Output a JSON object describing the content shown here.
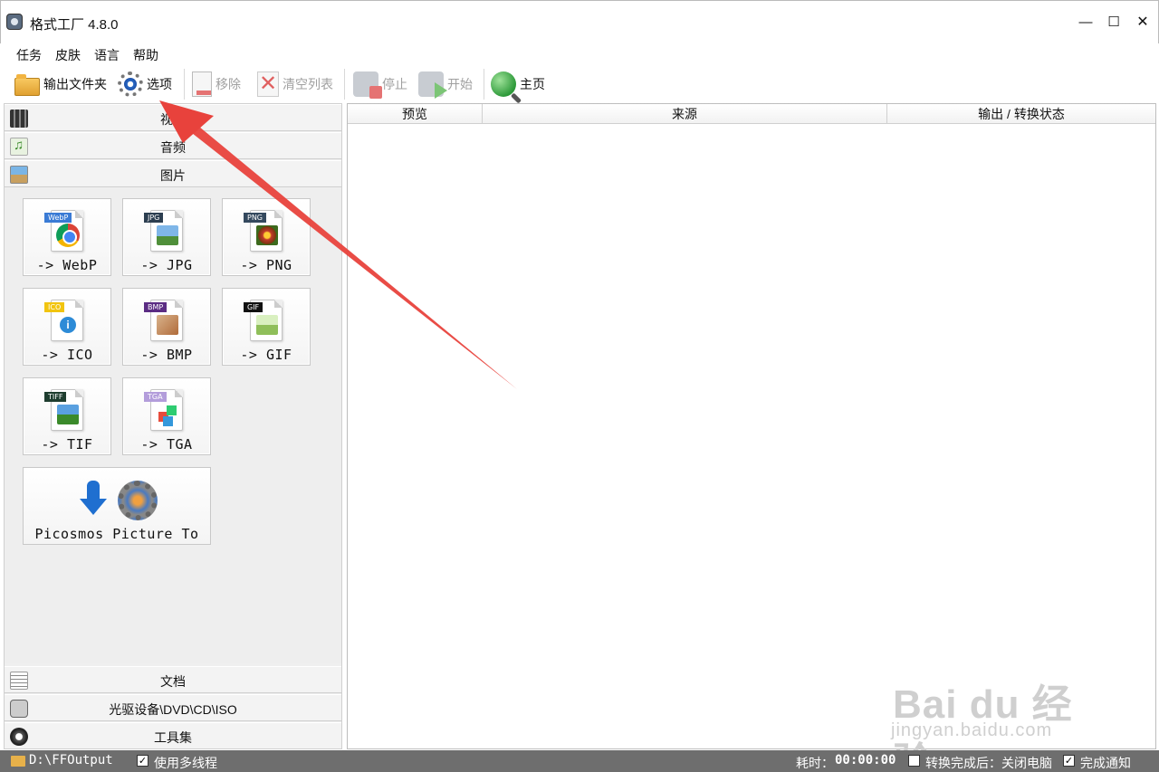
{
  "window": {
    "title": "格式工厂 4.8.0",
    "min_glyph": "—",
    "max_glyph": "☐",
    "close_glyph": "✕"
  },
  "menu": {
    "items": [
      "任务",
      "皮肤",
      "语言",
      "帮助"
    ]
  },
  "toolbar": {
    "output_folder": "输出文件夹",
    "options": "选项",
    "remove": "移除",
    "clear_list": "清空列表",
    "stop": "停止",
    "start": "开始",
    "home": "主页"
  },
  "left_panel": {
    "categories_top": [
      "视频",
      "音频",
      "图片"
    ],
    "tiles": [
      {
        "label": "-> WebP",
        "tag": "WebP",
        "tag_color": "#3a7bd5"
      },
      {
        "label": "-> JPG",
        "tag": "JPG",
        "tag_color": "#2c3e50"
      },
      {
        "label": "-> PNG",
        "tag": "PNG",
        "tag_color": "#34495e"
      },
      {
        "label": "-> ICO",
        "tag": "ICO",
        "tag_color": "#f1c40f"
      },
      {
        "label": "-> BMP",
        "tag": "BMP",
        "tag_color": "#5b2c83"
      },
      {
        "label": "-> GIF",
        "tag": "GIF",
        "tag_color": "#111111"
      },
      {
        "label": "-> TIF",
        "tag": "TIFF",
        "tag_color": "#1e3d2f"
      },
      {
        "label": "-> TGA",
        "tag": "TGA",
        "tag_color": "#b39ddb"
      }
    ],
    "pico_tile": "Picosmos Picture To",
    "categories_bottom": [
      "文档",
      "光驱设备\\DVD\\CD\\ISO",
      "工具集"
    ]
  },
  "right_panel": {
    "columns": [
      "预览",
      "来源",
      "输出 / 转换状态"
    ]
  },
  "status_bar": {
    "output_path": "D:\\FFOutput",
    "multithread_label": "使用多线程",
    "multithread_checked": "✓",
    "elapsed_label": "耗时：",
    "elapsed_value": "00:00:00",
    "after_convert_label": "转换完成后：关闭电脑",
    "after_convert_checked": "",
    "notify_label": "完成通知",
    "notify_checked": "✓"
  },
  "watermark": {
    "brand": "Bai du 经验",
    "url": "jingyan.baidu.com"
  },
  "colors": {
    "annotation_arrow": "#e8423c",
    "status_bar": "#6e6e6e"
  }
}
